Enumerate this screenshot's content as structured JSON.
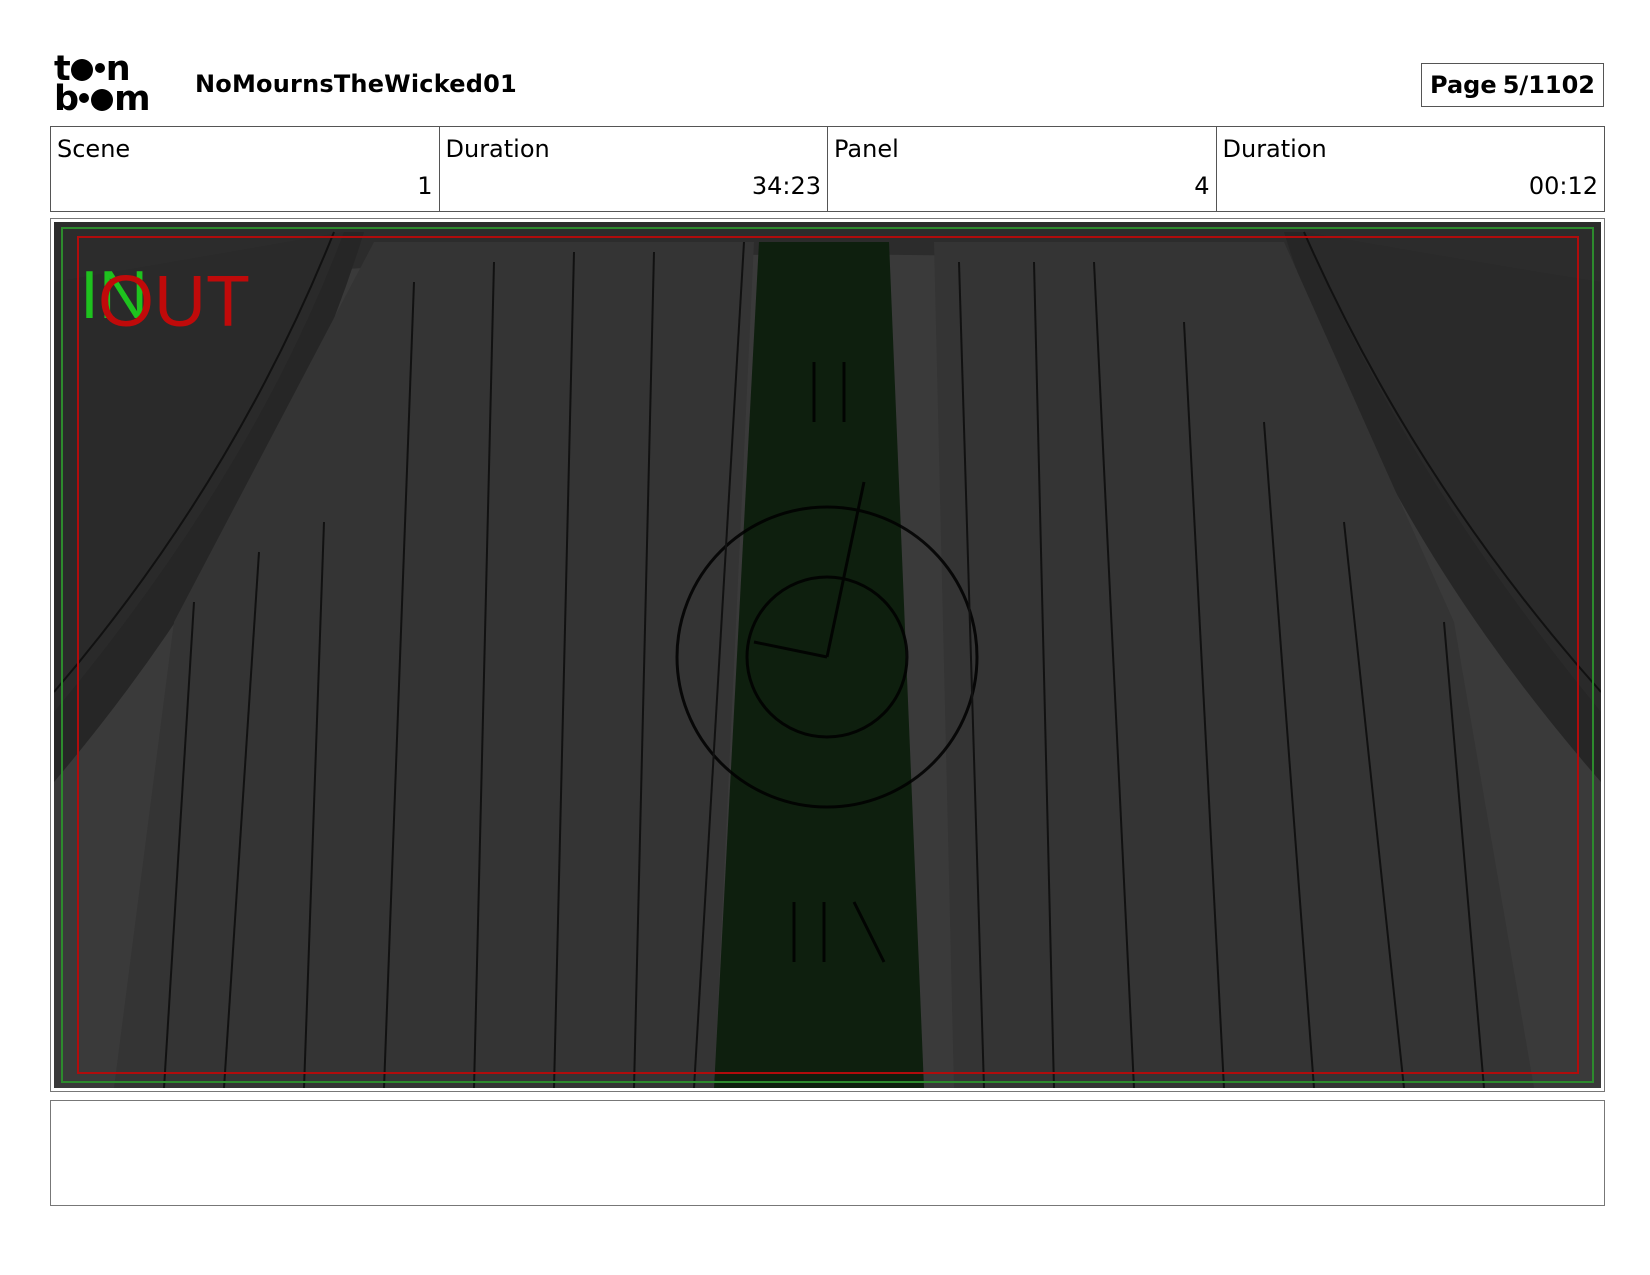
{
  "header": {
    "logo_line1": "t",
    "logo_line1_end": "n",
    "logo_line2": "b",
    "logo_line2_end": "m",
    "project_title": "NoMournsTheWicked01",
    "page_label": "Page",
    "page_value": "5/1102"
  },
  "info": {
    "scene_label": "Scene",
    "scene_value": "1",
    "scene_duration_label": "Duration",
    "scene_duration_value": "34:23",
    "panel_label": "Panel",
    "panel_value": "4",
    "panel_duration_label": "Duration",
    "panel_duration_value": "00:12"
  },
  "panel": {
    "in_label": "IN",
    "out_label": "OUT",
    "colors": {
      "background": "#3a3a3a",
      "curtain": "#353535",
      "curtain_shadow": "#262626",
      "window_green": "#0e1f0e",
      "safe_frame": "#b00c0c",
      "title_frame": "#2d8a2d",
      "in_text": "#1ec21e",
      "out_text": "#c00a0a"
    }
  },
  "notes": {
    "text": ""
  }
}
